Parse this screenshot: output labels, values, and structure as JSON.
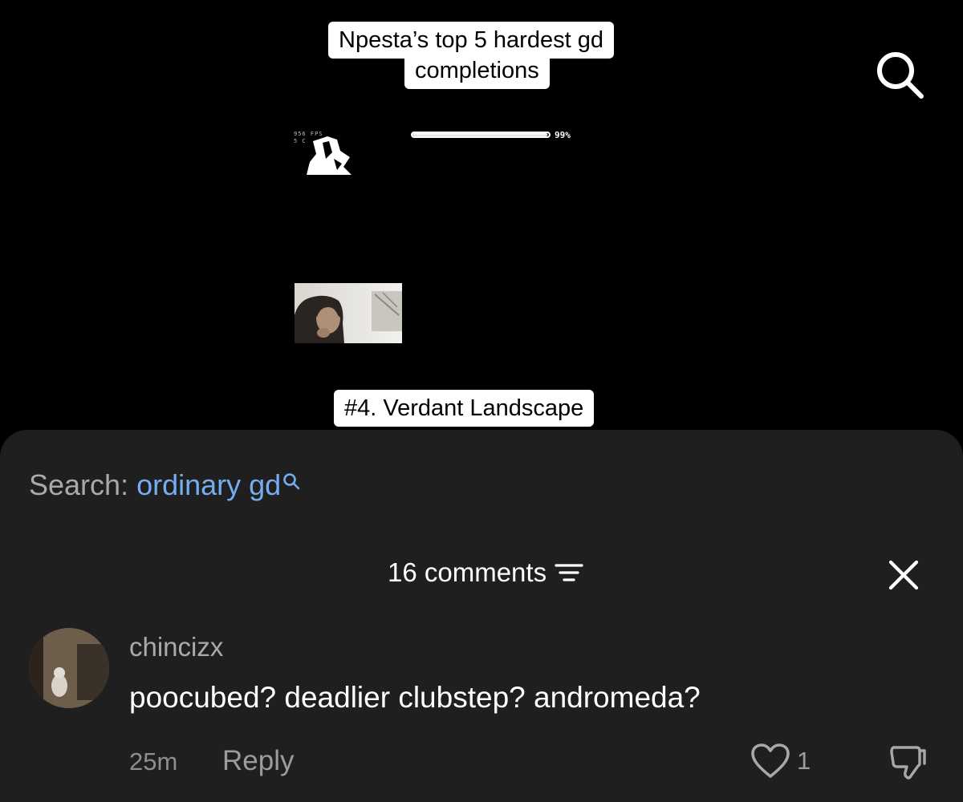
{
  "video": {
    "caption_title_line1": "Npesta’s top 5 hardest gd",
    "caption_title_line2": "completions",
    "level_caption": "#4. Verdant Landscape",
    "hud_stats_line1": "956 FPS",
    "hud_stats_line2": "5 C",
    "progress_percent_label": "99%",
    "progress_fraction": 0.99
  },
  "search_suggestion": {
    "prefix": "Search:",
    "term": "ordinary gd"
  },
  "comments_panel": {
    "header": "16 comments",
    "comments": [
      {
        "username": "chincizx",
        "text": "poocubed? deadlier clubstep? andromeda?",
        "time": "25m",
        "reply_label": "Reply",
        "like_count": "1"
      }
    ]
  },
  "icons": {
    "top_search": "search-icon",
    "inline_search": "search-icon",
    "filter": "filter-icon",
    "close": "close-icon",
    "like": "heart-icon",
    "dislike": "thumbs-down-icon"
  },
  "colors": {
    "background": "#000000",
    "sheet": "#1f1f1f",
    "search_term": "#76adf0",
    "muted_text": "#aaaaaa"
  }
}
